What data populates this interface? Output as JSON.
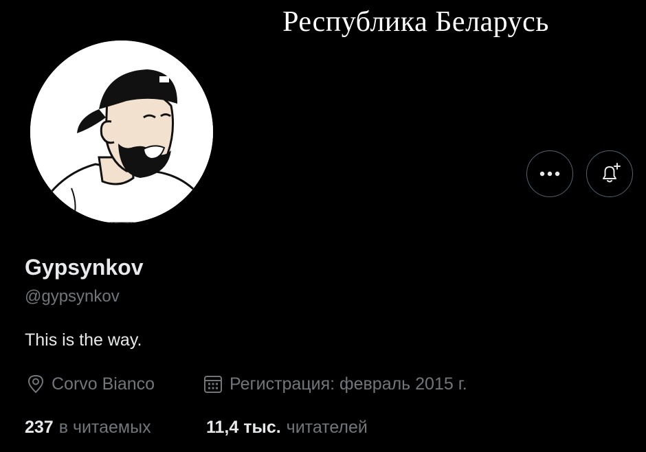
{
  "banner": {
    "text": "Республика Беларусь"
  },
  "profile": {
    "name": "Gypsynkov",
    "handle": "@gypsynkov",
    "bio": "This is the way.",
    "location": "Corvo Bianco",
    "joined": "Регистрация: февраль 2015 г."
  },
  "stats": {
    "following_count": "237",
    "following_label": "в читаемых",
    "followers_count": "11,4 тыс.",
    "followers_label": "читателей"
  },
  "icons": {
    "more": "more-horizontal-icon",
    "notify": "bell-plus-icon",
    "location": "location-pin-icon",
    "calendar": "calendar-icon"
  },
  "colors": {
    "background": "#000000",
    "text_primary": "#e7e9ea",
    "text_secondary": "#71767b",
    "button_border": "#536471"
  }
}
